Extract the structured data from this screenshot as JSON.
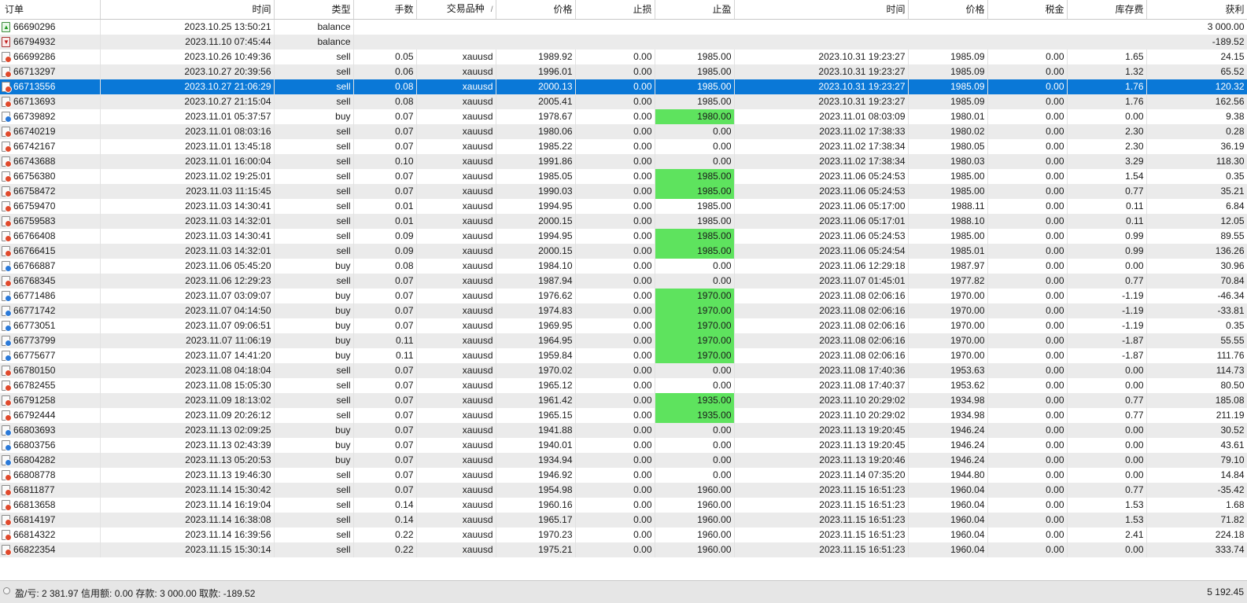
{
  "columns": [
    "订单",
    "时间",
    "类型",
    "手数",
    "交易品种",
    "价格",
    "止损",
    "止盈",
    "时间",
    "价格",
    "税金",
    "库存费",
    "获利"
  ],
  "sort_indicator": "/",
  "balances": [
    {
      "order": "66690296",
      "time": "2023.10.25 13:50:21",
      "type": "balance",
      "profit": "3 000.00",
      "icon": "deposit-icon"
    },
    {
      "order": "66794932",
      "time": "2023.11.10 07:45:44",
      "type": "balance",
      "profit": "-189.52",
      "icon": "withdraw-icon"
    }
  ],
  "trades": [
    {
      "order": "66699286",
      "open_time": "2023.10.26 10:49:36",
      "type": "sell",
      "volume": "0.05",
      "symbol": "xauusd",
      "open_price": "1989.92",
      "sl": "0.00",
      "tp": "1985.00",
      "close_time": "2023.10.31 19:23:27",
      "close_price": "1985.09",
      "tax": "0.00",
      "swap": "1.65",
      "profit": "24.15",
      "tp_hit": false,
      "selected": false
    },
    {
      "order": "66713297",
      "open_time": "2023.10.27 20:39:56",
      "type": "sell",
      "volume": "0.06",
      "symbol": "xauusd",
      "open_price": "1996.01",
      "sl": "0.00",
      "tp": "1985.00",
      "close_time": "2023.10.31 19:23:27",
      "close_price": "1985.09",
      "tax": "0.00",
      "swap": "1.32",
      "profit": "65.52",
      "tp_hit": false,
      "selected": false
    },
    {
      "order": "66713556",
      "open_time": "2023.10.27 21:06:29",
      "type": "sell",
      "volume": "0.08",
      "symbol": "xauusd",
      "open_price": "2000.13",
      "sl": "0.00",
      "tp": "1985.00",
      "close_time": "2023.10.31 19:23:27",
      "close_price": "1985.09",
      "tax": "0.00",
      "swap": "1.76",
      "profit": "120.32",
      "tp_hit": false,
      "selected": true
    },
    {
      "order": "66713693",
      "open_time": "2023.10.27 21:15:04",
      "type": "sell",
      "volume": "0.08",
      "symbol": "xauusd",
      "open_price": "2005.41",
      "sl": "0.00",
      "tp": "1985.00",
      "close_time": "2023.10.31 19:23:27",
      "close_price": "1985.09",
      "tax": "0.00",
      "swap": "1.76",
      "profit": "162.56",
      "tp_hit": false,
      "selected": false
    },
    {
      "order": "66739892",
      "open_time": "2023.11.01 05:37:57",
      "type": "buy",
      "volume": "0.07",
      "symbol": "xauusd",
      "open_price": "1978.67",
      "sl": "0.00",
      "tp": "1980.00",
      "close_time": "2023.11.01 08:03:09",
      "close_price": "1980.01",
      "tax": "0.00",
      "swap": "0.00",
      "profit": "9.38",
      "tp_hit": true,
      "selected": false
    },
    {
      "order": "66740219",
      "open_time": "2023.11.01 08:03:16",
      "type": "sell",
      "volume": "0.07",
      "symbol": "xauusd",
      "open_price": "1980.06",
      "sl": "0.00",
      "tp": "0.00",
      "close_time": "2023.11.02 17:38:33",
      "close_price": "1980.02",
      "tax": "0.00",
      "swap": "2.30",
      "profit": "0.28",
      "tp_hit": false,
      "selected": false
    },
    {
      "order": "66742167",
      "open_time": "2023.11.01 13:45:18",
      "type": "sell",
      "volume": "0.07",
      "symbol": "xauusd",
      "open_price": "1985.22",
      "sl": "0.00",
      "tp": "0.00",
      "close_time": "2023.11.02 17:38:34",
      "close_price": "1980.05",
      "tax": "0.00",
      "swap": "2.30",
      "profit": "36.19",
      "tp_hit": false,
      "selected": false
    },
    {
      "order": "66743688",
      "open_time": "2023.11.01 16:00:04",
      "type": "sell",
      "volume": "0.10",
      "symbol": "xauusd",
      "open_price": "1991.86",
      "sl": "0.00",
      "tp": "0.00",
      "close_time": "2023.11.02 17:38:34",
      "close_price": "1980.03",
      "tax": "0.00",
      "swap": "3.29",
      "profit": "118.30",
      "tp_hit": false,
      "selected": false
    },
    {
      "order": "66756380",
      "open_time": "2023.11.02 19:25:01",
      "type": "sell",
      "volume": "0.07",
      "symbol": "xauusd",
      "open_price": "1985.05",
      "sl": "0.00",
      "tp": "1985.00",
      "close_time": "2023.11.06 05:24:53",
      "close_price": "1985.00",
      "tax": "0.00",
      "swap": "1.54",
      "profit": "0.35",
      "tp_hit": true,
      "selected": false
    },
    {
      "order": "66758472",
      "open_time": "2023.11.03 11:15:45",
      "type": "sell",
      "volume": "0.07",
      "symbol": "xauusd",
      "open_price": "1990.03",
      "sl": "0.00",
      "tp": "1985.00",
      "close_time": "2023.11.06 05:24:53",
      "close_price": "1985.00",
      "tax": "0.00",
      "swap": "0.77",
      "profit": "35.21",
      "tp_hit": true,
      "selected": false
    },
    {
      "order": "66759470",
      "open_time": "2023.11.03 14:30:41",
      "type": "sell",
      "volume": "0.01",
      "symbol": "xauusd",
      "open_price": "1994.95",
      "sl": "0.00",
      "tp": "1985.00",
      "close_time": "2023.11.06 05:17:00",
      "close_price": "1988.11",
      "tax": "0.00",
      "swap": "0.11",
      "profit": "6.84",
      "tp_hit": false,
      "selected": false
    },
    {
      "order": "66759583",
      "open_time": "2023.11.03 14:32:01",
      "type": "sell",
      "volume": "0.01",
      "symbol": "xauusd",
      "open_price": "2000.15",
      "sl": "0.00",
      "tp": "1985.00",
      "close_time": "2023.11.06 05:17:01",
      "close_price": "1988.10",
      "tax": "0.00",
      "swap": "0.11",
      "profit": "12.05",
      "tp_hit": false,
      "selected": false
    },
    {
      "order": "66766408",
      "open_time": "2023.11.03 14:30:41",
      "type": "sell",
      "volume": "0.09",
      "symbol": "xauusd",
      "open_price": "1994.95",
      "sl": "0.00",
      "tp": "1985.00",
      "close_time": "2023.11.06 05:24:53",
      "close_price": "1985.00",
      "tax": "0.00",
      "swap": "0.99",
      "profit": "89.55",
      "tp_hit": true,
      "selected": false
    },
    {
      "order": "66766415",
      "open_time": "2023.11.03 14:32:01",
      "type": "sell",
      "volume": "0.09",
      "symbol": "xauusd",
      "open_price": "2000.15",
      "sl": "0.00",
      "tp": "1985.00",
      "close_time": "2023.11.06 05:24:54",
      "close_price": "1985.01",
      "tax": "0.00",
      "swap": "0.99",
      "profit": "136.26",
      "tp_hit": true,
      "selected": false
    },
    {
      "order": "66766887",
      "open_time": "2023.11.06 05:45:20",
      "type": "buy",
      "volume": "0.08",
      "symbol": "xauusd",
      "open_price": "1984.10",
      "sl": "0.00",
      "tp": "0.00",
      "close_time": "2023.11.06 12:29:18",
      "close_price": "1987.97",
      "tax": "0.00",
      "swap": "0.00",
      "profit": "30.96",
      "tp_hit": false,
      "selected": false
    },
    {
      "order": "66768345",
      "open_time": "2023.11.06 12:29:23",
      "type": "sell",
      "volume": "0.07",
      "symbol": "xauusd",
      "open_price": "1987.94",
      "sl": "0.00",
      "tp": "0.00",
      "close_time": "2023.11.07 01:45:01",
      "close_price": "1977.82",
      "tax": "0.00",
      "swap": "0.77",
      "profit": "70.84",
      "tp_hit": false,
      "selected": false
    },
    {
      "order": "66771486",
      "open_time": "2023.11.07 03:09:07",
      "type": "buy",
      "volume": "0.07",
      "symbol": "xauusd",
      "open_price": "1976.62",
      "sl": "0.00",
      "tp": "1970.00",
      "close_time": "2023.11.08 02:06:16",
      "close_price": "1970.00",
      "tax": "0.00",
      "swap": "-1.19",
      "profit": "-46.34",
      "tp_hit": true,
      "selected": false
    },
    {
      "order": "66771742",
      "open_time": "2023.11.07 04:14:50",
      "type": "buy",
      "volume": "0.07",
      "symbol": "xauusd",
      "open_price": "1974.83",
      "sl": "0.00",
      "tp": "1970.00",
      "close_time": "2023.11.08 02:06:16",
      "close_price": "1970.00",
      "tax": "0.00",
      "swap": "-1.19",
      "profit": "-33.81",
      "tp_hit": true,
      "selected": false
    },
    {
      "order": "66773051",
      "open_time": "2023.11.07 09:06:51",
      "type": "buy",
      "volume": "0.07",
      "symbol": "xauusd",
      "open_price": "1969.95",
      "sl": "0.00",
      "tp": "1970.00",
      "close_time": "2023.11.08 02:06:16",
      "close_price": "1970.00",
      "tax": "0.00",
      "swap": "-1.19",
      "profit": "0.35",
      "tp_hit": true,
      "selected": false
    },
    {
      "order": "66773799",
      "open_time": "2023.11.07 11:06:19",
      "type": "buy",
      "volume": "0.11",
      "symbol": "xauusd",
      "open_price": "1964.95",
      "sl": "0.00",
      "tp": "1970.00",
      "close_time": "2023.11.08 02:06:16",
      "close_price": "1970.00",
      "tax": "0.00",
      "swap": "-1.87",
      "profit": "55.55",
      "tp_hit": true,
      "selected": false
    },
    {
      "order": "66775677",
      "open_time": "2023.11.07 14:41:20",
      "type": "buy",
      "volume": "0.11",
      "symbol": "xauusd",
      "open_price": "1959.84",
      "sl": "0.00",
      "tp": "1970.00",
      "close_time": "2023.11.08 02:06:16",
      "close_price": "1970.00",
      "tax": "0.00",
      "swap": "-1.87",
      "profit": "111.76",
      "tp_hit": true,
      "selected": false
    },
    {
      "order": "66780150",
      "open_time": "2023.11.08 04:18:04",
      "type": "sell",
      "volume": "0.07",
      "symbol": "xauusd",
      "open_price": "1970.02",
      "sl": "0.00",
      "tp": "0.00",
      "close_time": "2023.11.08 17:40:36",
      "close_price": "1953.63",
      "tax": "0.00",
      "swap": "0.00",
      "profit": "114.73",
      "tp_hit": false,
      "selected": false
    },
    {
      "order": "66782455",
      "open_time": "2023.11.08 15:05:30",
      "type": "sell",
      "volume": "0.07",
      "symbol": "xauusd",
      "open_price": "1965.12",
      "sl": "0.00",
      "tp": "0.00",
      "close_time": "2023.11.08 17:40:37",
      "close_price": "1953.62",
      "tax": "0.00",
      "swap": "0.00",
      "profit": "80.50",
      "tp_hit": false,
      "selected": false
    },
    {
      "order": "66791258",
      "open_time": "2023.11.09 18:13:02",
      "type": "sell",
      "volume": "0.07",
      "symbol": "xauusd",
      "open_price": "1961.42",
      "sl": "0.00",
      "tp": "1935.00",
      "close_time": "2023.11.10 20:29:02",
      "close_price": "1934.98",
      "tax": "0.00",
      "swap": "0.77",
      "profit": "185.08",
      "tp_hit": true,
      "selected": false
    },
    {
      "order": "66792444",
      "open_time": "2023.11.09 20:26:12",
      "type": "sell",
      "volume": "0.07",
      "symbol": "xauusd",
      "open_price": "1965.15",
      "sl": "0.00",
      "tp": "1935.00",
      "close_time": "2023.11.10 20:29:02",
      "close_price": "1934.98",
      "tax": "0.00",
      "swap": "0.77",
      "profit": "211.19",
      "tp_hit": true,
      "selected": false
    },
    {
      "order": "66803693",
      "open_time": "2023.11.13 02:09:25",
      "type": "buy",
      "volume": "0.07",
      "symbol": "xauusd",
      "open_price": "1941.88",
      "sl": "0.00",
      "tp": "0.00",
      "close_time": "2023.11.13 19:20:45",
      "close_price": "1946.24",
      "tax": "0.00",
      "swap": "0.00",
      "profit": "30.52",
      "tp_hit": false,
      "selected": false
    },
    {
      "order": "66803756",
      "open_time": "2023.11.13 02:43:39",
      "type": "buy",
      "volume": "0.07",
      "symbol": "xauusd",
      "open_price": "1940.01",
      "sl": "0.00",
      "tp": "0.00",
      "close_time": "2023.11.13 19:20:45",
      "close_price": "1946.24",
      "tax": "0.00",
      "swap": "0.00",
      "profit": "43.61",
      "tp_hit": false,
      "selected": false
    },
    {
      "order": "66804282",
      "open_time": "2023.11.13 05:20:53",
      "type": "buy",
      "volume": "0.07",
      "symbol": "xauusd",
      "open_price": "1934.94",
      "sl": "0.00",
      "tp": "0.00",
      "close_time": "2023.11.13 19:20:46",
      "close_price": "1946.24",
      "tax": "0.00",
      "swap": "0.00",
      "profit": "79.10",
      "tp_hit": false,
      "selected": false
    },
    {
      "order": "66808778",
      "open_time": "2023.11.13 19:46:30",
      "type": "sell",
      "volume": "0.07",
      "symbol": "xauusd",
      "open_price": "1946.92",
      "sl": "0.00",
      "tp": "0.00",
      "close_time": "2023.11.14 07:35:20",
      "close_price": "1944.80",
      "tax": "0.00",
      "swap": "0.00",
      "profit": "14.84",
      "tp_hit": false,
      "selected": false
    },
    {
      "order": "66811877",
      "open_time": "2023.11.14 15:30:42",
      "type": "sell",
      "volume": "0.07",
      "symbol": "xauusd",
      "open_price": "1954.98",
      "sl": "0.00",
      "tp": "1960.00",
      "close_time": "2023.11.15 16:51:23",
      "close_price": "1960.04",
      "tax": "0.00",
      "swap": "0.77",
      "profit": "-35.42",
      "tp_hit": false,
      "selected": false
    },
    {
      "order": "66813658",
      "open_time": "2023.11.14 16:19:04",
      "type": "sell",
      "volume": "0.14",
      "symbol": "xauusd",
      "open_price": "1960.16",
      "sl": "0.00",
      "tp": "1960.00",
      "close_time": "2023.11.15 16:51:23",
      "close_price": "1960.04",
      "tax": "0.00",
      "swap": "1.53",
      "profit": "1.68",
      "tp_hit": false,
      "selected": false
    },
    {
      "order": "66814197",
      "open_time": "2023.11.14 16:38:08",
      "type": "sell",
      "volume": "0.14",
      "symbol": "xauusd",
      "open_price": "1965.17",
      "sl": "0.00",
      "tp": "1960.00",
      "close_time": "2023.11.15 16:51:23",
      "close_price": "1960.04",
      "tax": "0.00",
      "swap": "1.53",
      "profit": "71.82",
      "tp_hit": false,
      "selected": false
    },
    {
      "order": "66814322",
      "open_time": "2023.11.14 16:39:56",
      "type": "sell",
      "volume": "0.22",
      "symbol": "xauusd",
      "open_price": "1970.23",
      "sl": "0.00",
      "tp": "1960.00",
      "close_time": "2023.11.15 16:51:23",
      "close_price": "1960.04",
      "tax": "0.00",
      "swap": "2.41",
      "profit": "224.18",
      "tp_hit": false,
      "selected": false
    },
    {
      "order": "66822354",
      "open_time": "2023.11.15 15:30:14",
      "type": "sell",
      "volume": "0.22",
      "symbol": "xauusd",
      "open_price": "1975.21",
      "sl": "0.00",
      "tp": "1960.00",
      "close_time": "2023.11.15 16:51:23",
      "close_price": "1960.04",
      "tax": "0.00",
      "swap": "0.00",
      "profit": "333.74",
      "tp_hit": false,
      "selected": false
    }
  ],
  "status_bar": {
    "summary": "盈/亏: 2 381.97  信用额: 0.00  存款: 3 000.00  取款: -189.52",
    "total": "5 192.45"
  },
  "colors": {
    "selected_row": "#0a78d7",
    "tp_hit": "#5ee35e",
    "alt_row": "#ebebeb"
  }
}
